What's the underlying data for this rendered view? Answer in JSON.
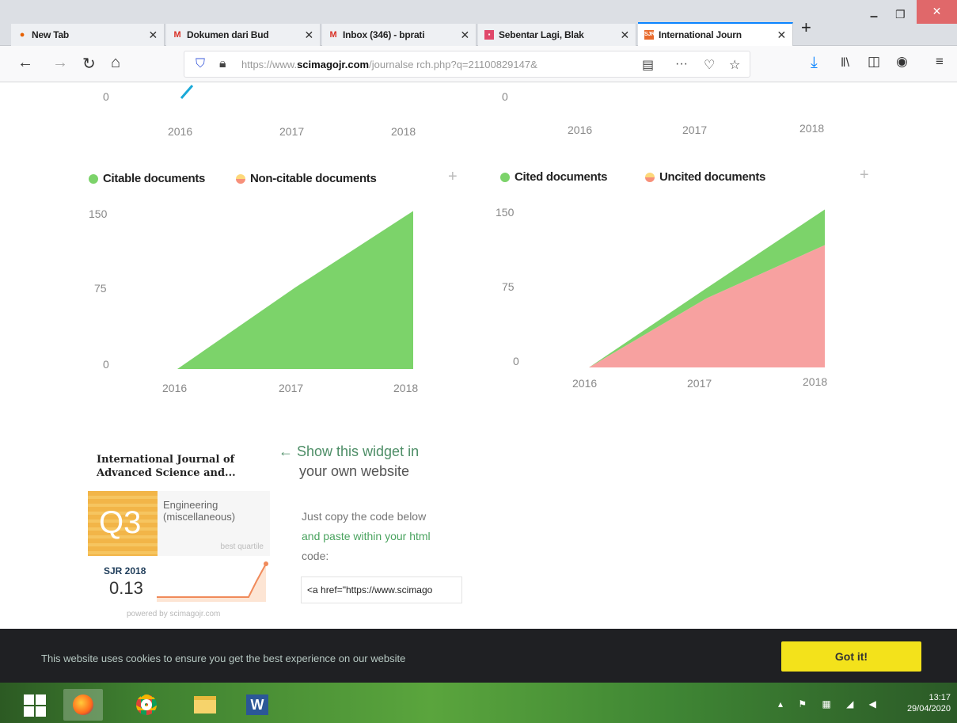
{
  "browser": {
    "tabs": [
      {
        "title": "New Tab",
        "favicon": "firefox-icon"
      },
      {
        "title": "Dokumen dari Bud",
        "favicon": "gmail-icon"
      },
      {
        "title": "Inbox (346) - bprati",
        "favicon": "gmail-icon"
      },
      {
        "title": "Sebentar Lagi, Blak",
        "favicon": "news-icon"
      },
      {
        "title": "International Journ",
        "favicon": "sjr-icon"
      }
    ],
    "url_prefix": "https://www.",
    "url_domain": "scimagojr.com",
    "url_rest": "/journalse rch.php?q=21100829147&",
    "new_tab_glyph": "+",
    "close_glyph": "✕"
  },
  "top_charts": {
    "left_y0": "0",
    "right_y0": "0",
    "left_years": [
      "2016",
      "2017",
      "2018"
    ],
    "right_years": [
      "2016",
      "2017",
      "2018"
    ]
  },
  "charts": {
    "left": {
      "legend": [
        {
          "label": "Citable documents",
          "color": "#7cd36a"
        },
        {
          "label": "Non-citable documents",
          "color": "#f7a58a"
        }
      ],
      "yticks": [
        "150",
        "75",
        "0"
      ],
      "xticks": [
        "2016",
        "2017",
        "2018"
      ]
    },
    "right": {
      "legend": [
        {
          "label": "Cited documents",
          "color": "#7cd36a"
        },
        {
          "label": "Uncited documents",
          "color": "#f7a58a"
        }
      ],
      "yticks": [
        "150",
        "75",
        "0"
      ],
      "xticks": [
        "2016",
        "2017",
        "2018"
      ]
    }
  },
  "chart_data": [
    {
      "type": "area",
      "x": [
        "2016",
        "2017",
        "2018"
      ],
      "series": [
        {
          "name": "Citable documents",
          "values": [
            0,
            80,
            155
          ]
        },
        {
          "name": "Non-citable documents",
          "values": [
            0,
            0,
            0
          ]
        }
      ],
      "ylim": [
        0,
        160
      ]
    },
    {
      "type": "area",
      "x": [
        "2016",
        "2017",
        "2018"
      ],
      "series": [
        {
          "name": "Cited documents",
          "values": [
            0,
            10,
            35
          ]
        },
        {
          "name": "Uncited documents",
          "values": [
            0,
            68,
            120
          ]
        }
      ],
      "ylim": [
        0,
        160
      ]
    }
  ],
  "widget": {
    "journal_title": "International Journal of Advanced Science and...",
    "quartile": "Q3",
    "category": "Engineering (miscellaneous)",
    "quartile_label": "best quartile",
    "sjr_year": "SJR 2018",
    "sjr_value": "0.13",
    "powered_by": "powered by scimagojr.com"
  },
  "share": {
    "title_line1": "← Show this widget in",
    "title_line2": "your own website",
    "copy_line1": "Just copy the code below",
    "copy_line2": "and paste within your html",
    "copy_line3": "code:",
    "code": "<a href=\"https://www.scimago"
  },
  "cookie": {
    "message": "This website uses cookies to ensure you get the best experience on our website",
    "button": "Got it!"
  },
  "taskbar": {
    "time": "13:17",
    "date": "29/04/2020",
    "word_label": "W"
  },
  "colors": {
    "green_area": "#7cd36a",
    "pink_area": "#f7a1a0",
    "accent": "#0a84ff"
  }
}
